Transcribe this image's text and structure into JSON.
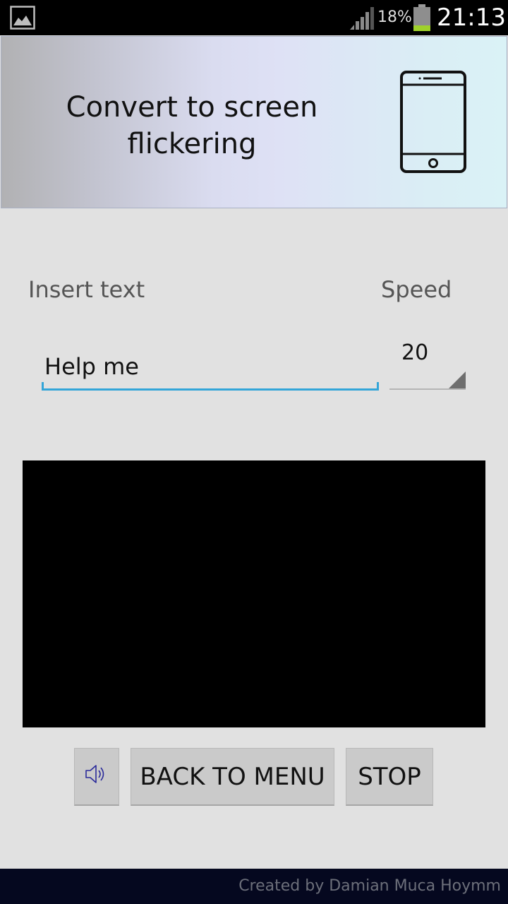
{
  "status_bar": {
    "battery_percent": "18%",
    "battery_level": 0.18,
    "time": "21:13",
    "icons": [
      "gallery-icon",
      "signal-icon",
      "battery-icon"
    ]
  },
  "banner": {
    "title": "Convert to screen flickering",
    "icon": "smartphone-icon"
  },
  "form": {
    "text_label": "Insert text",
    "speed_label": "Speed",
    "text_value": "Help me",
    "speed_value": "20"
  },
  "display": {
    "color": "#000000"
  },
  "buttons": {
    "sound_icon": "speaker-icon",
    "back_label": "BACK TO MENU",
    "stop_label": "STOP"
  },
  "footer": {
    "credit": "Created by Damian Muca Hoymm"
  },
  "colors": {
    "background": "#e1e1e1",
    "input_accent": "#33a5d8",
    "button": "#cacaca",
    "footer": "#05081f",
    "sound_icon": "#2a2a9a"
  }
}
